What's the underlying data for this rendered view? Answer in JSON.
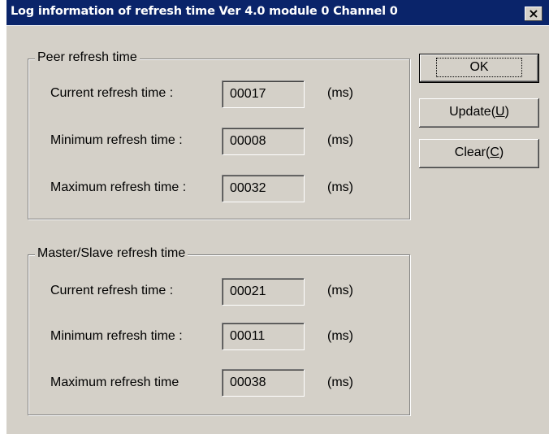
{
  "window": {
    "title": "Log information of refresh time  Ver 4.0 module 0 Channel 0",
    "close_glyph": "✕"
  },
  "peer_group": {
    "title": "Peer refresh time",
    "rows": [
      {
        "label": "Current refresh time :",
        "value": "00017",
        "unit": "(ms)"
      },
      {
        "label": "Minimum refresh time :",
        "value": "00008",
        "unit": "(ms)"
      },
      {
        "label": "Maximum refresh time :",
        "value": "00032",
        "unit": "(ms)"
      }
    ]
  },
  "master_group": {
    "title": "Master/Slave refresh time",
    "rows": [
      {
        "label": "Current refresh time :",
        "value": "00021",
        "unit": "(ms)"
      },
      {
        "label": "Minimum refresh time :",
        "value": "00011",
        "unit": "(ms)"
      },
      {
        "label": "Maximum refresh time",
        "value": "00038",
        "unit": "(ms)"
      }
    ]
  },
  "buttons": {
    "ok": "OK",
    "update": "Update(",
    "update_key": "U",
    "clear": "Clear(",
    "clear_key": "C",
    "close_paren": ")"
  }
}
